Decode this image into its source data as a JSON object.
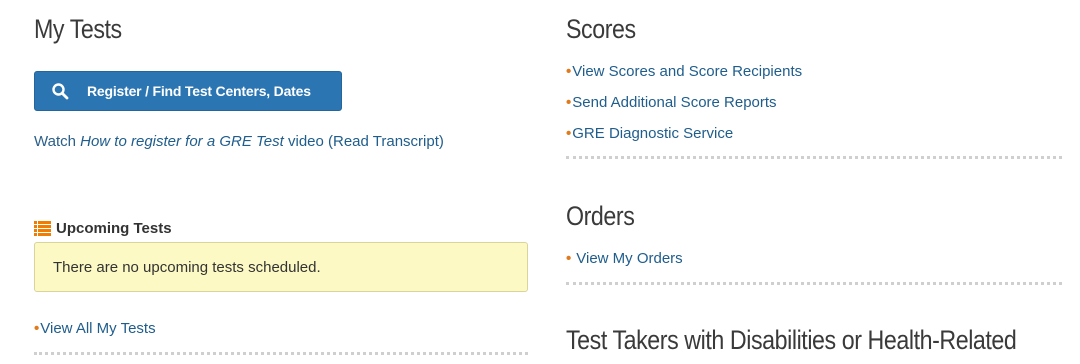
{
  "my_tests": {
    "title": "My Tests",
    "register_button_label": "Register / Find Test Centers, Dates",
    "watch_prefix": "Watch ",
    "watch_video_title": "How to register for a GRE Test",
    "watch_suffix": " video ",
    "read_transcript": "(Read Transcript)",
    "upcoming_title": "Upcoming Tests",
    "no_upcoming": "There are no upcoming tests scheduled.",
    "view_all": "View All My Tests"
  },
  "scores": {
    "title": "Scores",
    "links": [
      "View Scores and Score Recipients",
      "Send Additional Score Reports",
      "GRE Diagnostic Service"
    ]
  },
  "orders": {
    "title": "Orders",
    "links": [
      "View My Orders"
    ]
  },
  "disabilities": {
    "title": "Test Takers with Disabilities or Health-Related"
  },
  "bullet_char": "•",
  "colors": {
    "accent_button": "#2b75b3",
    "link": "#1f5d8c",
    "bullet": "#e07a1b",
    "notice_bg": "#fcf9c4",
    "list_icon": "#f07d00"
  },
  "icons": {
    "button_icon": "search-icon",
    "upcoming_icon": "list-icon"
  }
}
